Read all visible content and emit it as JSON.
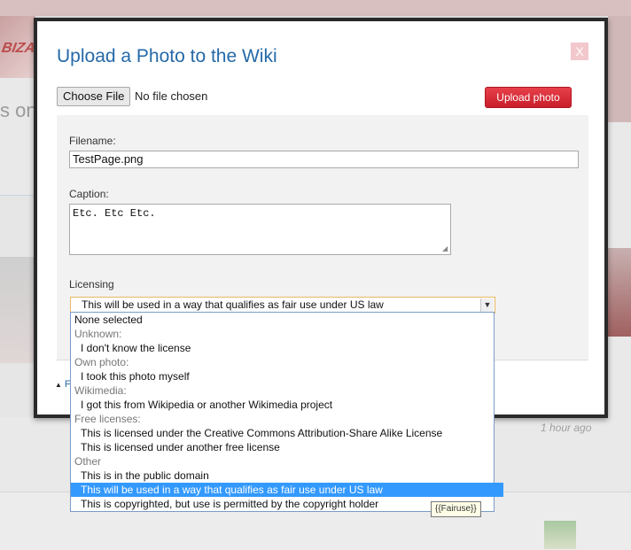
{
  "modal": {
    "title": "Upload a Photo to the Wiki",
    "close_label": "X",
    "choose_file_label": "Choose File",
    "file_status": "No file chosen",
    "upload_label": "Upload photo",
    "filename_label": "Filename:",
    "filename_value": "TestPage.png",
    "caption_label": "Caption:",
    "caption_value": "Etc. Etc Etc.",
    "licensing_label": "Licensing",
    "licensing_selected": "This will be used in a way that qualifies as fair use under US law",
    "more_link": "F"
  },
  "dropdown": {
    "options": [
      {
        "label": "None selected",
        "kind": "top"
      },
      {
        "label": "Unknown:",
        "kind": "group"
      },
      {
        "label": "I don't know the license",
        "kind": "item"
      },
      {
        "label": "Own photo:",
        "kind": "group"
      },
      {
        "label": "I took this photo myself",
        "kind": "item"
      },
      {
        "label": "Wikimedia:",
        "kind": "group"
      },
      {
        "label": "I got this from Wikipedia or another Wikimedia project",
        "kind": "item"
      },
      {
        "label": "Free licenses:",
        "kind": "group"
      },
      {
        "label": "This is licensed under the Creative Commons Attribution-Share Alike License",
        "kind": "item"
      },
      {
        "label": "This is licensed under another free license",
        "kind": "item"
      },
      {
        "label": "Other",
        "kind": "group"
      },
      {
        "label": "This is in the public domain",
        "kind": "item"
      },
      {
        "label": "This will be used in a way that qualifies as fair use under US law",
        "kind": "item",
        "selected": true
      },
      {
        "label": "This is copyrighted, but use is permitted by the copyright holder",
        "kind": "item"
      }
    ],
    "tooltip": "{{Fairuse}}"
  },
  "background": {
    "logo_text": "BIZA",
    "left_text": "s on",
    "timestamp": "1 hour ago"
  },
  "colors": {
    "title_blue": "#2569a8",
    "upload_red": "#d8242e",
    "selection_blue": "#3399ff"
  }
}
